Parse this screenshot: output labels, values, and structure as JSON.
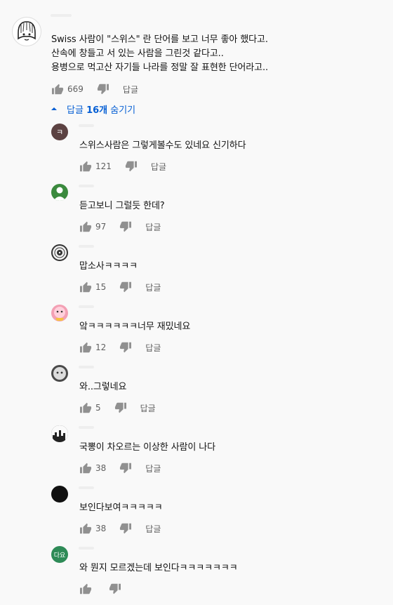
{
  "main_comment": {
    "lines": [
      "Swiss 사람이 \"스위스\" 란 단어를 보고 너무 좋아 했다고.",
      "산속에 창들고 서 있는 사람을 그린것 같다고..",
      "용병으로 먹고산 자기들 나라를 정말 잘 표현한 단어라고.."
    ],
    "likes": "669",
    "reply_label": "답글"
  },
  "replies_toggle": {
    "prefix": "답글 ",
    "count": "16개",
    "suffix": " 숨기기"
  },
  "replies": [
    {
      "avatar_text": "ㅋ",
      "avatar_color": "#5c4242",
      "text": "스위스사람은 그렇게볼수도 있네요 신기하다",
      "likes": "121",
      "reply_label": "답글"
    },
    {
      "avatar_text": "",
      "avatar_color": "#3b8a3e",
      "text": "듣고보니 그럴듯 한데?",
      "likes": "97",
      "reply_label": "답글"
    },
    {
      "avatar_text": "",
      "avatar_color": "#333333",
      "text": "맙소사ㅋㅋㅋㅋ",
      "likes": "15",
      "reply_label": "답글"
    },
    {
      "avatar_text": "",
      "avatar_color": "#f3a0b4",
      "text": "앜ㅋㅋㅋㅋㅋㅋ너무 재밌네요",
      "likes": "12",
      "reply_label": "답글"
    },
    {
      "avatar_text": "",
      "avatar_color": "#4a4a4a",
      "text": "와..그렇네요",
      "likes": "5",
      "reply_label": "답글"
    },
    {
      "avatar_text": "",
      "avatar_color": "#222222",
      "text": "국뽕이 차오르는 이상한 사람이 나다",
      "likes": "38",
      "reply_label": "답글"
    },
    {
      "avatar_text": "",
      "avatar_color": "#111111",
      "text": "보인다보여ㅋㅋㅋㅋㅋ",
      "likes": "38",
      "reply_label": "답글"
    },
    {
      "avatar_text": "다요",
      "avatar_color": "#2e8b57",
      "text": "와 뭔지 모르겠는데 보인다ㅋㅋㅋㅋㅋㅋㅋ",
      "likes": "",
      "reply_label": ""
    }
  ],
  "colors": {
    "background": "#f9f9f9",
    "link_blue": "#065fd4",
    "meta_grey": "#606060",
    "icon_grey": "#909090"
  },
  "icons": {
    "like": "thumbs-up-icon",
    "dislike": "thumbs-down-icon",
    "toggle": "caret-up-icon"
  }
}
